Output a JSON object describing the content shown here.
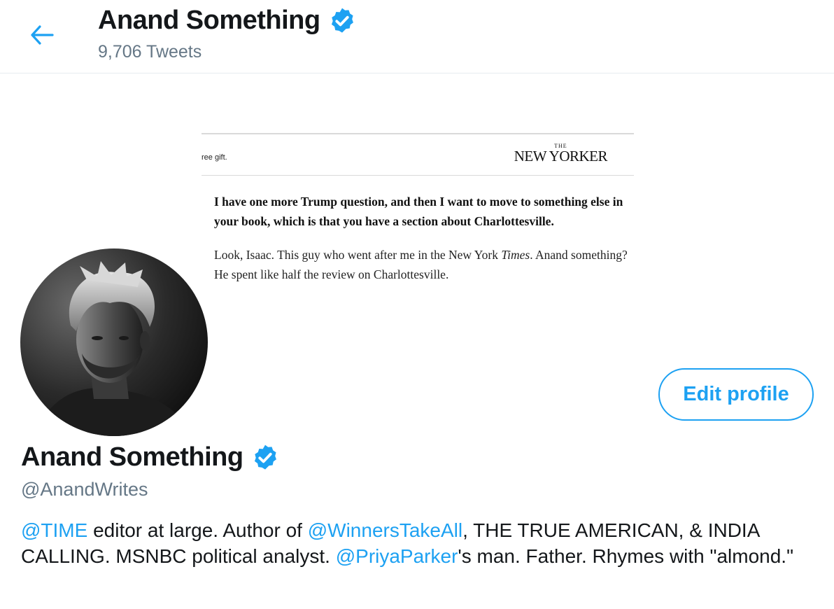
{
  "header": {
    "title": "Anand Something",
    "tweet_count": "9,706 Tweets"
  },
  "banner": {
    "gift_text": "ree gift.",
    "logo_small": "THE",
    "logo_name": "NEW YORKER",
    "question": "I have one more Trump question, and then I want to move to something else in your book, which is that you have a section about Charlottesville.",
    "answer_part1": "Look, Isaac. This guy who went after me in the New York ",
    "answer_italic": "Times",
    "answer_part2": ". Anand something? He spent like half the review on Charlottesville."
  },
  "edit_profile_label": "Edit profile",
  "profile": {
    "name": "Anand Something",
    "handle": "@AnandWrites",
    "bio": {
      "mention_time": "@TIME",
      "text1": " editor at large. Author of ",
      "mention_winners": "@WinnersTakeAll",
      "text2": ", THE TRUE AMERICAN, & INDIA CALLING. MSNBC political analyst. ",
      "mention_priya": "@PriyaParker",
      "text3": "'s man. Father. Rhymes with \"almond.\""
    }
  },
  "colors": {
    "accent": "#1da1f2",
    "secondary_text": "#657786",
    "primary_text": "#14171a",
    "divider": "#e6ecf0"
  },
  "icons": {
    "back": "arrow-left-icon",
    "verified": "verified-badge-icon"
  }
}
